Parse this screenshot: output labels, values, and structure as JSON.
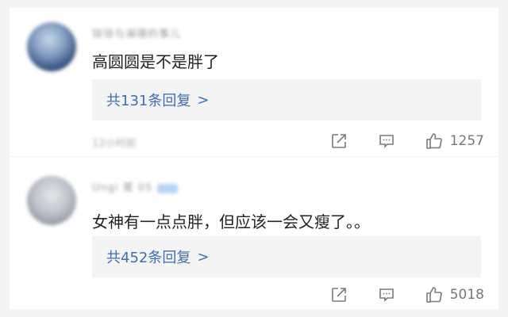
{
  "comments": [
    {
      "username": "琼琼与澜珊的事儿",
      "content": "高圆圆是不是胖了",
      "replies_label": "共131条回复",
      "replies_chevron": ">",
      "time": "12小时前",
      "like_count": "1257"
    },
    {
      "username": "Ungi 箐 05",
      "content": "女神有一点点胖，但应该一会又瘦了。。",
      "replies_label": "共452条回复",
      "replies_chevron": ">",
      "time": "",
      "like_count": "5018"
    }
  ],
  "icons": {
    "share": "share-icon",
    "comment": "comment-icon",
    "like": "thumbs-up-icon"
  },
  "colors": {
    "link": "#3d6fb3",
    "reply_bg": "#f4f4f4",
    "icon": "#7a7a7a"
  }
}
